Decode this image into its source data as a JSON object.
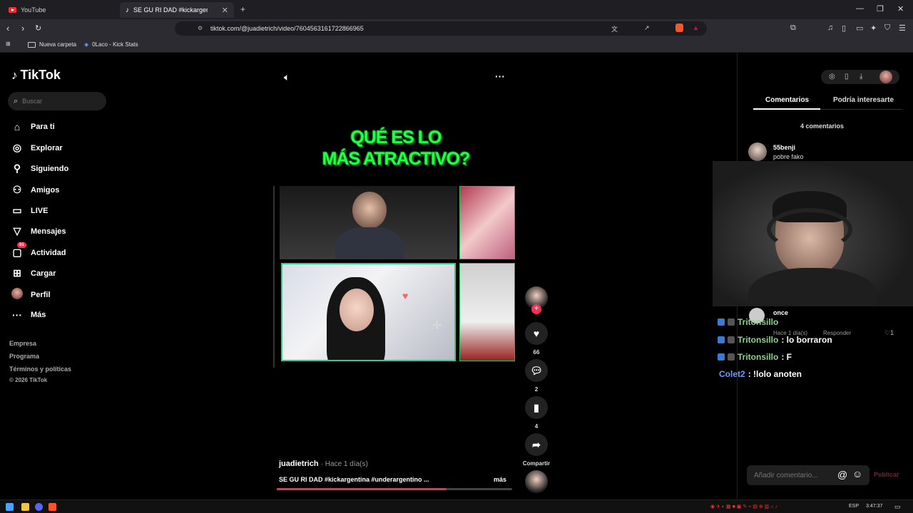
{
  "browser": {
    "tabs": [
      {
        "label": "YouTube",
        "active": false
      },
      {
        "label": "SE GU RI DAD #kickargentina",
        "active": true
      }
    ],
    "new_tab": "+",
    "url": "tiktok.com/@juadietrich/video/7604563161722866965",
    "bookmarks": [
      {
        "label": "Nueva carpeta"
      },
      {
        "label": "0Laco - Kick Stats"
      }
    ]
  },
  "tiktok": {
    "logo": "TikTok",
    "search_placeholder": "Buscar",
    "nav": [
      {
        "label": "Para ti",
        "icon": "home-icon"
      },
      {
        "label": "Explorar",
        "icon": "compass-icon"
      },
      {
        "label": "Siguiendo",
        "icon": "following-icon"
      },
      {
        "label": "Amigos",
        "icon": "friends-icon"
      },
      {
        "label": "LIVE",
        "icon": "live-icon"
      },
      {
        "label": "Mensajes",
        "icon": "messages-icon"
      },
      {
        "label": "Actividad",
        "icon": "activity-icon",
        "badge": "91"
      },
      {
        "label": "Cargar",
        "icon": "upload-icon"
      },
      {
        "label": "Perfil",
        "icon": "avatar"
      },
      {
        "label": "Más",
        "icon": "more-icon"
      }
    ],
    "footer": [
      "Empresa",
      "Programa",
      "Términos y políticas",
      "© 2026 TikTok"
    ]
  },
  "video": {
    "overlay_title_line1": "QUÉ ES LO",
    "overlay_title_line2": "MÁS ATRACTIVO?",
    "author": "juadietrich",
    "posted": "· Hace 1 día(s)",
    "description": "SE GU RI DAD #kickargentina #underargentino  ...",
    "more": "más",
    "progress": 0.72,
    "likes": "66",
    "comments": "2",
    "saves": "4",
    "share_label": "Compartir"
  },
  "panel": {
    "tab_comments": "Comentarios",
    "tab_interest": "Podría interesarte",
    "count": "4 comentarios",
    "comments": [
      {
        "name": "55benji",
        "text": "pobre fako"
      },
      {
        "name": "once",
        "time": "Hace 1 día(s)",
        "reply": "Responder",
        "likes": "1"
      }
    ],
    "add_placeholder": "Añadir comentario...",
    "post": "Publicar"
  },
  "chat": [
    {
      "name": "Tritonsillo",
      "msg": "",
      "color": "#8fd18f"
    },
    {
      "name": "Tritonsillo",
      "msg": " : lo borraron",
      "color": "#8fd18f"
    },
    {
      "name": "Tritonsillo",
      "msg": " : F",
      "color": "#8fd18f"
    },
    {
      "name": "Colet2",
      "msg": " : !lolo anoten",
      "color": "#6b9dff"
    }
  ],
  "chat_fragment": "Tritonsillo",
  "taskbar": {
    "lang": "ESP",
    "time": "3:47:37"
  }
}
